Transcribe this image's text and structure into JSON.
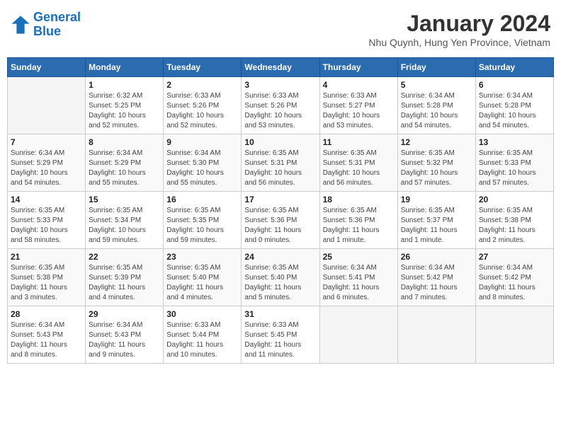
{
  "header": {
    "logo_line1": "General",
    "logo_line2": "Blue",
    "month": "January 2024",
    "location": "Nhu Quynh, Hung Yen Province, Vietnam"
  },
  "weekdays": [
    "Sunday",
    "Monday",
    "Tuesday",
    "Wednesday",
    "Thursday",
    "Friday",
    "Saturday"
  ],
  "weeks": [
    [
      {
        "day": "",
        "info": ""
      },
      {
        "day": "1",
        "info": "Sunrise: 6:32 AM\nSunset: 5:25 PM\nDaylight: 10 hours\nand 52 minutes."
      },
      {
        "day": "2",
        "info": "Sunrise: 6:33 AM\nSunset: 5:26 PM\nDaylight: 10 hours\nand 52 minutes."
      },
      {
        "day": "3",
        "info": "Sunrise: 6:33 AM\nSunset: 5:26 PM\nDaylight: 10 hours\nand 53 minutes."
      },
      {
        "day": "4",
        "info": "Sunrise: 6:33 AM\nSunset: 5:27 PM\nDaylight: 10 hours\nand 53 minutes."
      },
      {
        "day": "5",
        "info": "Sunrise: 6:34 AM\nSunset: 5:28 PM\nDaylight: 10 hours\nand 54 minutes."
      },
      {
        "day": "6",
        "info": "Sunrise: 6:34 AM\nSunset: 5:28 PM\nDaylight: 10 hours\nand 54 minutes."
      }
    ],
    [
      {
        "day": "7",
        "info": "Sunrise: 6:34 AM\nSunset: 5:29 PM\nDaylight: 10 hours\nand 54 minutes."
      },
      {
        "day": "8",
        "info": "Sunrise: 6:34 AM\nSunset: 5:29 PM\nDaylight: 10 hours\nand 55 minutes."
      },
      {
        "day": "9",
        "info": "Sunrise: 6:34 AM\nSunset: 5:30 PM\nDaylight: 10 hours\nand 55 minutes."
      },
      {
        "day": "10",
        "info": "Sunrise: 6:35 AM\nSunset: 5:31 PM\nDaylight: 10 hours\nand 56 minutes."
      },
      {
        "day": "11",
        "info": "Sunrise: 6:35 AM\nSunset: 5:31 PM\nDaylight: 10 hours\nand 56 minutes."
      },
      {
        "day": "12",
        "info": "Sunrise: 6:35 AM\nSunset: 5:32 PM\nDaylight: 10 hours\nand 57 minutes."
      },
      {
        "day": "13",
        "info": "Sunrise: 6:35 AM\nSunset: 5:33 PM\nDaylight: 10 hours\nand 57 minutes."
      }
    ],
    [
      {
        "day": "14",
        "info": "Sunrise: 6:35 AM\nSunset: 5:33 PM\nDaylight: 10 hours\nand 58 minutes."
      },
      {
        "day": "15",
        "info": "Sunrise: 6:35 AM\nSunset: 5:34 PM\nDaylight: 10 hours\nand 59 minutes."
      },
      {
        "day": "16",
        "info": "Sunrise: 6:35 AM\nSunset: 5:35 PM\nDaylight: 10 hours\nand 59 minutes."
      },
      {
        "day": "17",
        "info": "Sunrise: 6:35 AM\nSunset: 5:36 PM\nDaylight: 11 hours\nand 0 minutes."
      },
      {
        "day": "18",
        "info": "Sunrise: 6:35 AM\nSunset: 5:36 PM\nDaylight: 11 hours\nand 1 minute."
      },
      {
        "day": "19",
        "info": "Sunrise: 6:35 AM\nSunset: 5:37 PM\nDaylight: 11 hours\nand 1 minute."
      },
      {
        "day": "20",
        "info": "Sunrise: 6:35 AM\nSunset: 5:38 PM\nDaylight: 11 hours\nand 2 minutes."
      }
    ],
    [
      {
        "day": "21",
        "info": "Sunrise: 6:35 AM\nSunset: 5:38 PM\nDaylight: 11 hours\nand 3 minutes."
      },
      {
        "day": "22",
        "info": "Sunrise: 6:35 AM\nSunset: 5:39 PM\nDaylight: 11 hours\nand 4 minutes."
      },
      {
        "day": "23",
        "info": "Sunrise: 6:35 AM\nSunset: 5:40 PM\nDaylight: 11 hours\nand 4 minutes."
      },
      {
        "day": "24",
        "info": "Sunrise: 6:35 AM\nSunset: 5:40 PM\nDaylight: 11 hours\nand 5 minutes."
      },
      {
        "day": "25",
        "info": "Sunrise: 6:34 AM\nSunset: 5:41 PM\nDaylight: 11 hours\nand 6 minutes."
      },
      {
        "day": "26",
        "info": "Sunrise: 6:34 AM\nSunset: 5:42 PM\nDaylight: 11 hours\nand 7 minutes."
      },
      {
        "day": "27",
        "info": "Sunrise: 6:34 AM\nSunset: 5:42 PM\nDaylight: 11 hours\nand 8 minutes."
      }
    ],
    [
      {
        "day": "28",
        "info": "Sunrise: 6:34 AM\nSunset: 5:43 PM\nDaylight: 11 hours\nand 8 minutes."
      },
      {
        "day": "29",
        "info": "Sunrise: 6:34 AM\nSunset: 5:43 PM\nDaylight: 11 hours\nand 9 minutes."
      },
      {
        "day": "30",
        "info": "Sunrise: 6:33 AM\nSunset: 5:44 PM\nDaylight: 11 hours\nand 10 minutes."
      },
      {
        "day": "31",
        "info": "Sunrise: 6:33 AM\nSunset: 5:45 PM\nDaylight: 11 hours\nand 11 minutes."
      },
      {
        "day": "",
        "info": ""
      },
      {
        "day": "",
        "info": ""
      },
      {
        "day": "",
        "info": ""
      }
    ]
  ]
}
